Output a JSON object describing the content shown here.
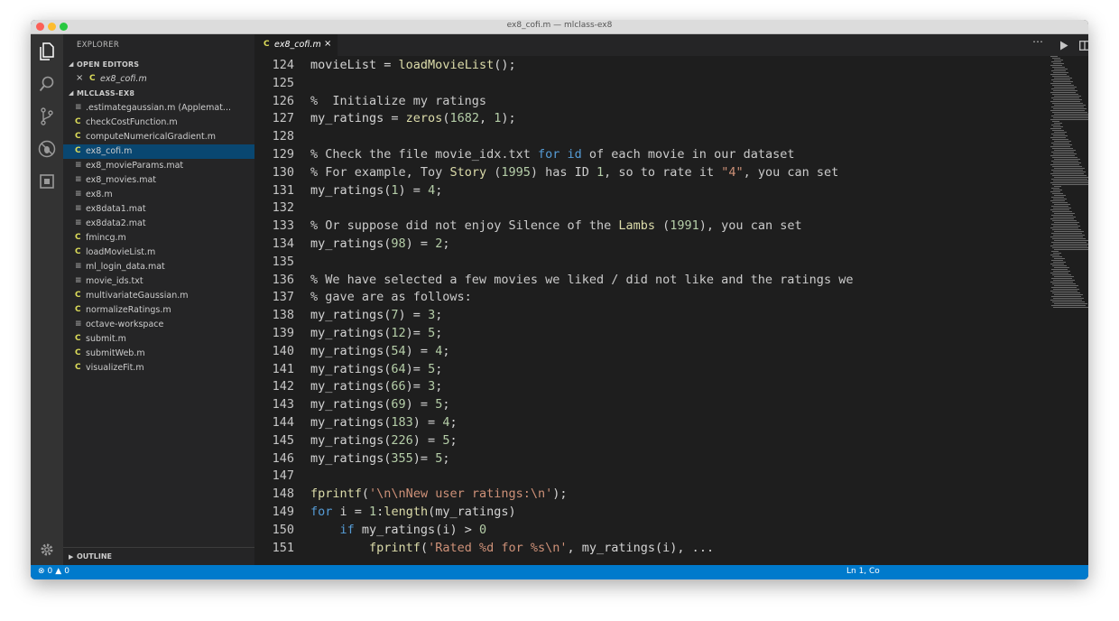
{
  "window": {
    "title": "ex8_cofi.m — mlclass-ex8"
  },
  "sidebar": {
    "header": "EXPLORER",
    "open_editors_label": "OPEN EDITORS",
    "open_editors": [
      {
        "name": "ex8_cofi.m",
        "icon": "matlab-c-icon"
      }
    ],
    "folder_label": "MLCLASS-EX8",
    "files": [
      {
        "name": ".estimategaussian.m (Applemat...",
        "icon": "file-icon",
        "selected": false
      },
      {
        "name": "checkCostFunction.m",
        "icon": "matlab-c-icon",
        "selected": false
      },
      {
        "name": "computeNumericalGradient.m",
        "icon": "matlab-c-icon",
        "selected": false
      },
      {
        "name": "ex8_cofi.m",
        "icon": "matlab-c-icon",
        "selected": true
      },
      {
        "name": "ex8_movieParams.mat",
        "icon": "file-icon",
        "selected": false
      },
      {
        "name": "ex8_movies.mat",
        "icon": "file-icon",
        "selected": false
      },
      {
        "name": "ex8.m",
        "icon": "file-icon",
        "selected": false
      },
      {
        "name": "ex8data1.mat",
        "icon": "file-icon",
        "selected": false
      },
      {
        "name": "ex8data2.mat",
        "icon": "file-icon",
        "selected": false
      },
      {
        "name": "fmincg.m",
        "icon": "matlab-c-icon",
        "selected": false
      },
      {
        "name": "loadMovieList.m",
        "icon": "matlab-c-icon",
        "selected": false
      },
      {
        "name": "ml_login_data.mat",
        "icon": "file-icon",
        "selected": false
      },
      {
        "name": "movie_ids.txt",
        "icon": "file-icon",
        "selected": false
      },
      {
        "name": "multivariateGaussian.m",
        "icon": "matlab-c-icon",
        "selected": false
      },
      {
        "name": "normalizeRatings.m",
        "icon": "matlab-c-icon",
        "selected": false
      },
      {
        "name": "octave-workspace",
        "icon": "file-icon",
        "selected": false
      },
      {
        "name": "submit.m",
        "icon": "matlab-c-icon",
        "selected": false
      },
      {
        "name": "submitWeb.m",
        "icon": "matlab-c-icon",
        "selected": false
      },
      {
        "name": "visualizeFit.m",
        "icon": "matlab-c-icon",
        "selected": false
      }
    ],
    "outline_label": "OUTLINE"
  },
  "editor": {
    "tab": {
      "name": "ex8_cofi.m",
      "close": "×"
    },
    "lines": [
      {
        "n": "124",
        "tokens": [
          [
            "t",
            "movieList = "
          ],
          [
            "f",
            "loadMovieList"
          ],
          [
            "t",
            "();"
          ]
        ]
      },
      {
        "n": "125",
        "tokens": []
      },
      {
        "n": "126",
        "tokens": [
          [
            "c",
            "%  Initialize my ratings"
          ]
        ]
      },
      {
        "n": "127",
        "tokens": [
          [
            "t",
            "my_ratings = "
          ],
          [
            "f",
            "zeros"
          ],
          [
            "t",
            "("
          ],
          [
            "n",
            "1682"
          ],
          [
            "t",
            ", "
          ],
          [
            "n",
            "1"
          ],
          [
            "t",
            ");"
          ]
        ]
      },
      {
        "n": "128",
        "tokens": []
      },
      {
        "n": "129",
        "tokens": [
          [
            "c",
            "% Check the file movie_idx.txt "
          ],
          [
            "k",
            "for"
          ],
          [
            "c",
            " "
          ],
          [
            "k",
            "id"
          ],
          [
            "c",
            " of each movie in our dataset"
          ]
        ]
      },
      {
        "n": "130",
        "tokens": [
          [
            "c",
            "% For example, Toy "
          ],
          [
            "f",
            "Story"
          ],
          [
            "c",
            " ("
          ],
          [
            "n",
            "1995"
          ],
          [
            "c",
            ") has ID "
          ],
          [
            "n",
            "1"
          ],
          [
            "c",
            ", so to rate it "
          ],
          [
            "s",
            "\"4\""
          ],
          [
            "c",
            ", you can set"
          ]
        ]
      },
      {
        "n": "131",
        "tokens": [
          [
            "t",
            "my_ratings("
          ],
          [
            "n",
            "1"
          ],
          [
            "t",
            ") = "
          ],
          [
            "n",
            "4"
          ],
          [
            "t",
            ";"
          ]
        ]
      },
      {
        "n": "132",
        "tokens": []
      },
      {
        "n": "133",
        "tokens": [
          [
            "c",
            "% Or suppose did not enjoy Silence of the "
          ],
          [
            "f",
            "Lambs"
          ],
          [
            "c",
            " ("
          ],
          [
            "n",
            "1991"
          ],
          [
            "c",
            "), you can set"
          ]
        ]
      },
      {
        "n": "134",
        "tokens": [
          [
            "t",
            "my_ratings("
          ],
          [
            "n",
            "98"
          ],
          [
            "t",
            ") = "
          ],
          [
            "n",
            "2"
          ],
          [
            "t",
            ";"
          ]
        ]
      },
      {
        "n": "135",
        "tokens": []
      },
      {
        "n": "136",
        "tokens": [
          [
            "c",
            "% We have selected a few movies we liked / did not like and the ratings we"
          ]
        ]
      },
      {
        "n": "137",
        "tokens": [
          [
            "c",
            "% gave are as follows:"
          ]
        ]
      },
      {
        "n": "138",
        "tokens": [
          [
            "t",
            "my_ratings("
          ],
          [
            "n",
            "7"
          ],
          [
            "t",
            ") = "
          ],
          [
            "n",
            "3"
          ],
          [
            "t",
            ";"
          ]
        ]
      },
      {
        "n": "139",
        "tokens": [
          [
            "t",
            "my_ratings("
          ],
          [
            "n",
            "12"
          ],
          [
            "t",
            ")= "
          ],
          [
            "n",
            "5"
          ],
          [
            "t",
            ";"
          ]
        ]
      },
      {
        "n": "140",
        "tokens": [
          [
            "t",
            "my_ratings("
          ],
          [
            "n",
            "54"
          ],
          [
            "t",
            ") = "
          ],
          [
            "n",
            "4"
          ],
          [
            "t",
            ";"
          ]
        ]
      },
      {
        "n": "141",
        "tokens": [
          [
            "t",
            "my_ratings("
          ],
          [
            "n",
            "64"
          ],
          [
            "t",
            ")= "
          ],
          [
            "n",
            "5"
          ],
          [
            "t",
            ";"
          ]
        ]
      },
      {
        "n": "142",
        "tokens": [
          [
            "t",
            "my_ratings("
          ],
          [
            "n",
            "66"
          ],
          [
            "t",
            ")= "
          ],
          [
            "n",
            "3"
          ],
          [
            "t",
            ";"
          ]
        ]
      },
      {
        "n": "143",
        "tokens": [
          [
            "t",
            "my_ratings("
          ],
          [
            "n",
            "69"
          ],
          [
            "t",
            ") = "
          ],
          [
            "n",
            "5"
          ],
          [
            "t",
            ";"
          ]
        ]
      },
      {
        "n": "144",
        "tokens": [
          [
            "t",
            "my_ratings("
          ],
          [
            "n",
            "183"
          ],
          [
            "t",
            ") = "
          ],
          [
            "n",
            "4"
          ],
          [
            "t",
            ";"
          ]
        ]
      },
      {
        "n": "145",
        "tokens": [
          [
            "t",
            "my_ratings("
          ],
          [
            "n",
            "226"
          ],
          [
            "t",
            ") = "
          ],
          [
            "n",
            "5"
          ],
          [
            "t",
            ";"
          ]
        ]
      },
      {
        "n": "146",
        "tokens": [
          [
            "t",
            "my_ratings("
          ],
          [
            "n",
            "355"
          ],
          [
            "t",
            ")= "
          ],
          [
            "n",
            "5"
          ],
          [
            "t",
            ";"
          ]
        ]
      },
      {
        "n": "147",
        "tokens": []
      },
      {
        "n": "148",
        "tokens": [
          [
            "f",
            "fprintf"
          ],
          [
            "t",
            "("
          ],
          [
            "s",
            "'\\n\\nNew user ratings:\\n'"
          ],
          [
            "t",
            ");"
          ]
        ]
      },
      {
        "n": "149",
        "tokens": [
          [
            "k",
            "for"
          ],
          [
            "t",
            " i = "
          ],
          [
            "n",
            "1"
          ],
          [
            "t",
            ":"
          ],
          [
            "f",
            "length"
          ],
          [
            "t",
            "(my_ratings)"
          ]
        ]
      },
      {
        "n": "150",
        "tokens": [
          [
            "t",
            "    "
          ],
          [
            "k",
            "if"
          ],
          [
            "t",
            " my_ratings(i) > "
          ],
          [
            "n",
            "0"
          ]
        ]
      },
      {
        "n": "151",
        "tokens": [
          [
            "t",
            "        "
          ],
          [
            "f",
            "fprintf"
          ],
          [
            "t",
            "("
          ],
          [
            "s",
            "'Rated %d for %s\\n'"
          ],
          [
            "t",
            ", my_ratings(i), ..."
          ]
        ]
      }
    ]
  },
  "statusbar": {
    "errors": "0",
    "warnings": "0",
    "position": "Ln 1, Co"
  },
  "colors": {
    "statusbar": "#007acc",
    "selection": "#094771",
    "activitybar": "#333333",
    "sidebar": "#252526",
    "editor": "#1e1e1e"
  }
}
